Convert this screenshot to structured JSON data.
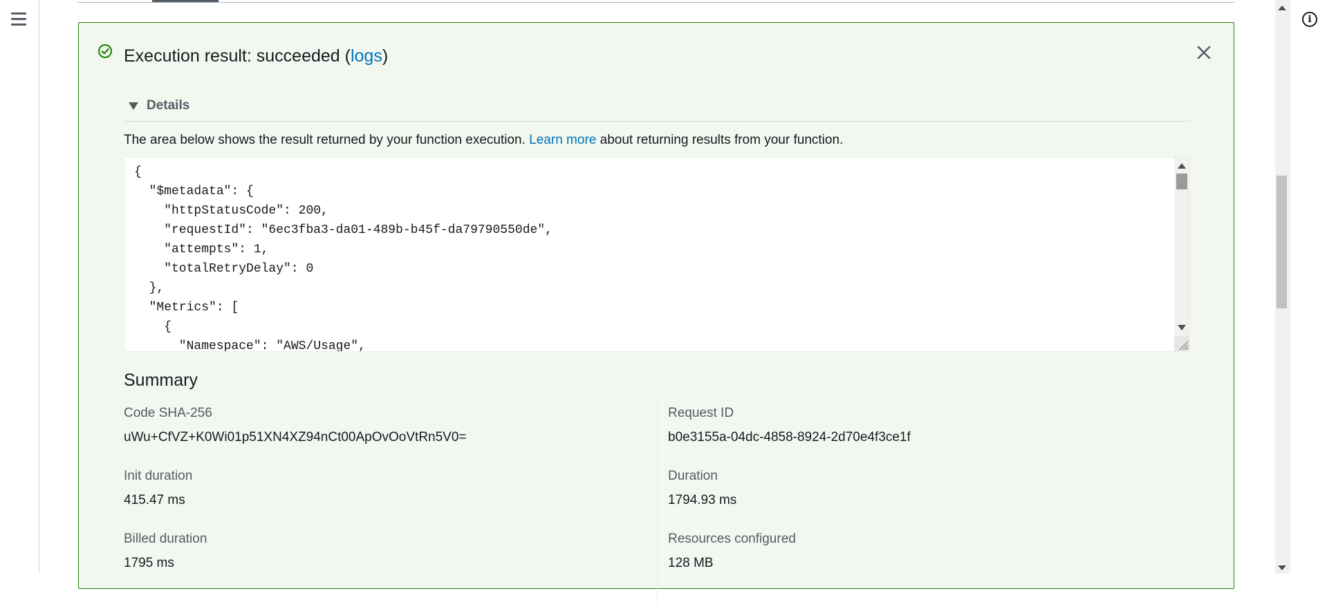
{
  "result": {
    "title_prefix": "Execution result: succeeded (",
    "title_link": "logs",
    "title_suffix": ")",
    "details_label": "Details",
    "description_before": "The area below shows the result returned by your function execution. ",
    "description_link": "Learn more",
    "description_after": " about returning results from your function.",
    "code_lines": [
      "{",
      "  \"$metadata\": {",
      "    \"httpStatusCode\": 200,",
      "    \"requestId\": \"6ec3fba3-da01-489b-b45f-da79790550de\",",
      "    \"attempts\": 1,",
      "    \"totalRetryDelay\": 0",
      "  },",
      "  \"Metrics\": [",
      "    {",
      "      \"Namespace\": \"AWS/Usage\","
    ]
  },
  "summary": {
    "title": "Summary",
    "left": [
      {
        "label": "Code SHA-256",
        "value": "uWu+CfVZ+K0Wi01p51XN4XZ94nCt00ApOvOoVtRn5V0="
      },
      {
        "label": "Init duration",
        "value": "415.47 ms"
      },
      {
        "label": "Billed duration",
        "value": "1795 ms"
      }
    ],
    "right": [
      {
        "label": "Request ID",
        "value": "b0e3155a-04dc-4858-8924-2d70e4f3ce1f"
      },
      {
        "label": "Duration",
        "value": "1794.93 ms"
      },
      {
        "label": "Resources configured",
        "value": "128 MB"
      }
    ]
  },
  "icons": {
    "menu": "hamburger-menu-icon",
    "info": "info-icon",
    "success": "check-circle-icon",
    "close": "close-icon"
  },
  "colors": {
    "success": "#1d8102",
    "panel_bg": "#f2f8f0",
    "link": "#0073bb",
    "text": "#16191f",
    "muted": "#545b64"
  }
}
